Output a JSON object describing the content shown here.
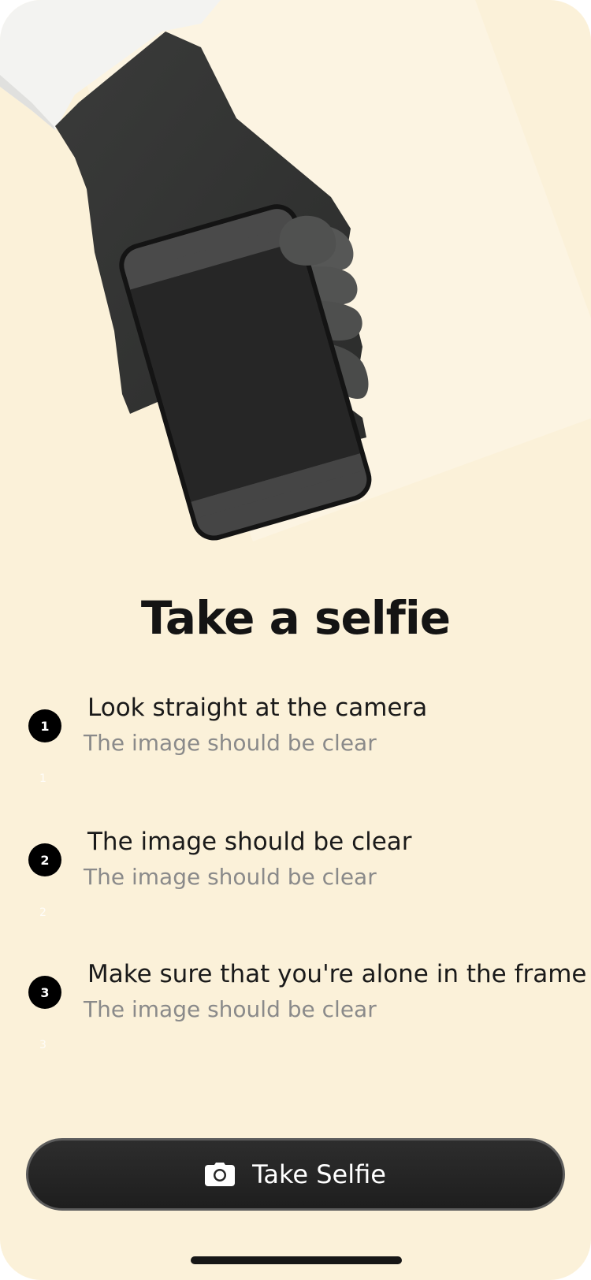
{
  "screen": {
    "title": "Take a selfie",
    "background_color": "#fbf1d9",
    "hero_image": "gloved-hand-holding-phone"
  },
  "steps": [
    {
      "number": "1",
      "title": "Look straight at the camera",
      "subtitle": "The image should be clear",
      "ghost_label": "1"
    },
    {
      "number": "2",
      "title": "The image should be clear",
      "subtitle": "The image should be clear",
      "ghost_label": "2"
    },
    {
      "number": "3",
      "title": "Make sure that you're alone in the frame",
      "subtitle": "The image should be clear",
      "ghost_label": "3"
    }
  ],
  "cta": {
    "label": "Take Selfie",
    "icon": "camera-icon",
    "background_color": "#262626"
  }
}
